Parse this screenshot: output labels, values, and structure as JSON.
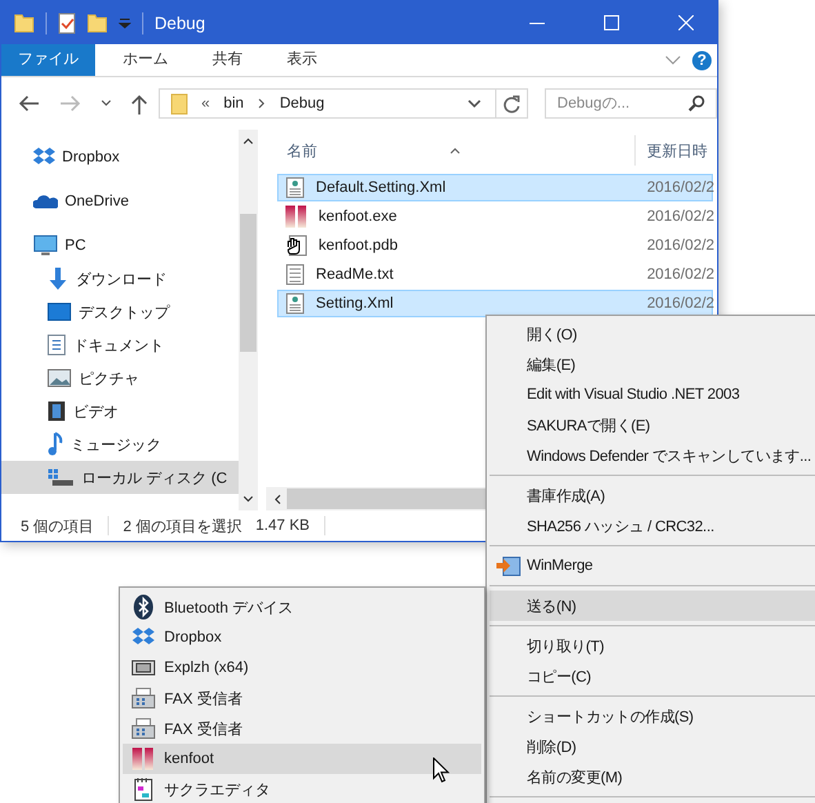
{
  "window": {
    "title": "Debug"
  },
  "ribbon": {
    "tabs": [
      {
        "label": "ファイル",
        "selected": true
      },
      {
        "label": "ホーム",
        "selected": false
      },
      {
        "label": "共有",
        "selected": false
      },
      {
        "label": "表示",
        "selected": false
      }
    ],
    "help": "?"
  },
  "address": {
    "overflow": "«",
    "path": [
      "bin",
      "Debug"
    ],
    "search": {
      "placeholder": "Debugの..."
    }
  },
  "navigation": [
    {
      "label": "Dropbox",
      "kind": "dropbox",
      "selected": false
    },
    {
      "label": "OneDrive",
      "kind": "cloud",
      "selected": false
    },
    {
      "label": "PC",
      "kind": "pc",
      "selected": false,
      "children": [
        {
          "label": "ダウンロード",
          "kind": "download",
          "selected": false
        },
        {
          "label": "デスクトップ",
          "kind": "desktop",
          "selected": false
        },
        {
          "label": "ドキュメント",
          "kind": "documents",
          "selected": false
        },
        {
          "label": "ピクチャ",
          "kind": "pictures",
          "selected": false
        },
        {
          "label": "ビデオ",
          "kind": "video",
          "selected": false
        },
        {
          "label": "ミュージック",
          "kind": "music",
          "selected": false
        },
        {
          "label": "ローカル ディスク (C",
          "kind": "drive",
          "selected": true
        }
      ]
    }
  ],
  "file_list": {
    "columns": [
      "名前",
      "更新日時"
    ],
    "rows": [
      {
        "name": "Default.Setting.Xml",
        "date": "2016/02/2",
        "kind": "xml",
        "selected": true
      },
      {
        "name": "kenfoot.exe",
        "date": "2016/02/2",
        "kind": "exe",
        "selected": false
      },
      {
        "name": "kenfoot.pdb",
        "date": "2016/02/2",
        "kind": "pdb",
        "selected": false
      },
      {
        "name": "ReadMe.txt",
        "date": "2016/02/2",
        "kind": "txt",
        "selected": false
      },
      {
        "name": "Setting.Xml",
        "date": "2016/02/2",
        "kind": "xml",
        "selected": true
      }
    ]
  },
  "status_bar": {
    "count": "5 個の項目",
    "selection": "2 個の項目を選択",
    "size": "1.47 KB"
  },
  "context_menu": [
    {
      "kind": "command",
      "label": "開く(O)",
      "selected": false
    },
    {
      "kind": "command",
      "label": "編集(E)",
      "selected": false
    },
    {
      "kind": "command",
      "label": "Edit with Visual Studio .NET 2003",
      "selected": false
    },
    {
      "kind": "command",
      "label": "SAKURAで開く(E)",
      "selected": false
    },
    {
      "kind": "command",
      "label": "Windows Defender でスキャンしています...",
      "selected": false
    },
    {
      "kind": "separator"
    },
    {
      "kind": "command",
      "label": "書庫作成(A)",
      "selected": false
    },
    {
      "kind": "command",
      "label": "SHA256 ハッシュ / CRC32...",
      "selected": false
    },
    {
      "kind": "separator"
    },
    {
      "kind": "winmerge",
      "label": "WinMerge",
      "selected": false
    },
    {
      "kind": "separator"
    },
    {
      "kind": "command",
      "label": "送る(N)",
      "selected": true
    },
    {
      "kind": "separator"
    },
    {
      "kind": "command",
      "label": "切り取り(T)",
      "selected": false
    },
    {
      "kind": "command",
      "label": "コピー(C)",
      "selected": false
    },
    {
      "kind": "separator"
    },
    {
      "kind": "command",
      "label": "ショートカットの作成(S)",
      "selected": false
    },
    {
      "kind": "command",
      "label": "削除(D)",
      "selected": false
    },
    {
      "kind": "command",
      "label": "名前の変更(M)",
      "selected": false
    },
    {
      "kind": "separator"
    }
  ],
  "send_to_menu": [
    {
      "kind": "bluetooth",
      "label": "Bluetooth デバイス",
      "selected": false
    },
    {
      "kind": "dropbox",
      "label": "Dropbox",
      "selected": false
    },
    {
      "kind": "archiver",
      "label": "Explzh (x64)",
      "selected": false
    },
    {
      "kind": "fax",
      "label": "FAX 受信者",
      "selected": false
    },
    {
      "kind": "fax",
      "label": "FAX 受信者",
      "selected": false
    },
    {
      "kind": "app",
      "label": "kenfoot",
      "selected": true
    },
    {
      "kind": "editor",
      "label": "サクラエディタ",
      "selected": false
    }
  ]
}
